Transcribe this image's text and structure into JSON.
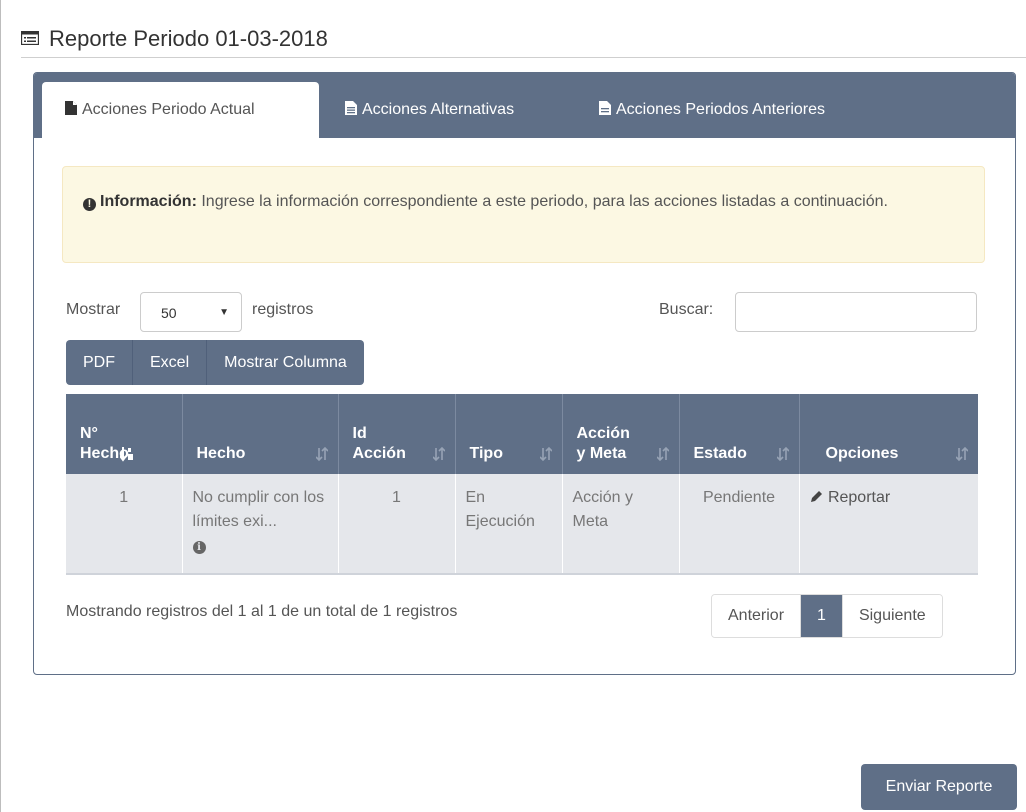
{
  "page": {
    "title": "Reporte Periodo 01-03-2018"
  },
  "tabs": [
    {
      "label": "Acciones Periodo Actual",
      "active": true,
      "icon": "file-icon"
    },
    {
      "label": "Acciones Alternativas",
      "active": false,
      "icon": "document-text-icon"
    },
    {
      "label": "Acciones Periodos Anteriores",
      "active": false,
      "icon": "file-text-icon"
    }
  ],
  "alert": {
    "title": "Información:",
    "message": "Ingrese la información correspondiente a este periodo, para las acciones listadas a continuación."
  },
  "table_controls": {
    "show_label": "Mostrar",
    "page_size": "50",
    "records_label": "registros",
    "search_label": "Buscar:",
    "search_value": ""
  },
  "export_buttons": [
    "PDF",
    "Excel",
    "Mostrar Columna"
  ],
  "table": {
    "columns": [
      {
        "line1": "N°",
        "line2": "Hecho"
      },
      {
        "line1": "",
        "line2": "Hecho"
      },
      {
        "line1": "Id",
        "line2": "Acción"
      },
      {
        "line1": "",
        "line2": "Tipo"
      },
      {
        "line1": "Acción",
        "line2": "y Meta"
      },
      {
        "line1": "",
        "line2": "Estado"
      },
      {
        "line1": "",
        "line2": "Opciones"
      }
    ],
    "rows": [
      {
        "n_hecho": "1",
        "hecho": "No cumplir con los límites exi...",
        "id_accion": "1",
        "tipo": "En Ejecución",
        "accion_meta": "Acción y Meta",
        "estado": "Pendiente",
        "opcion": "Reportar"
      }
    ]
  },
  "footer": {
    "info": "Mostrando registros del 1 al 1 de un total de 1 registros",
    "prev": "Anterior",
    "current": "1",
    "next": "Siguiente"
  },
  "send_button": "Enviar Reporte",
  "colors": {
    "primary": "#5f6f87",
    "alert_bg": "#fcf8e3",
    "row_bg": "#e5e7eb"
  }
}
